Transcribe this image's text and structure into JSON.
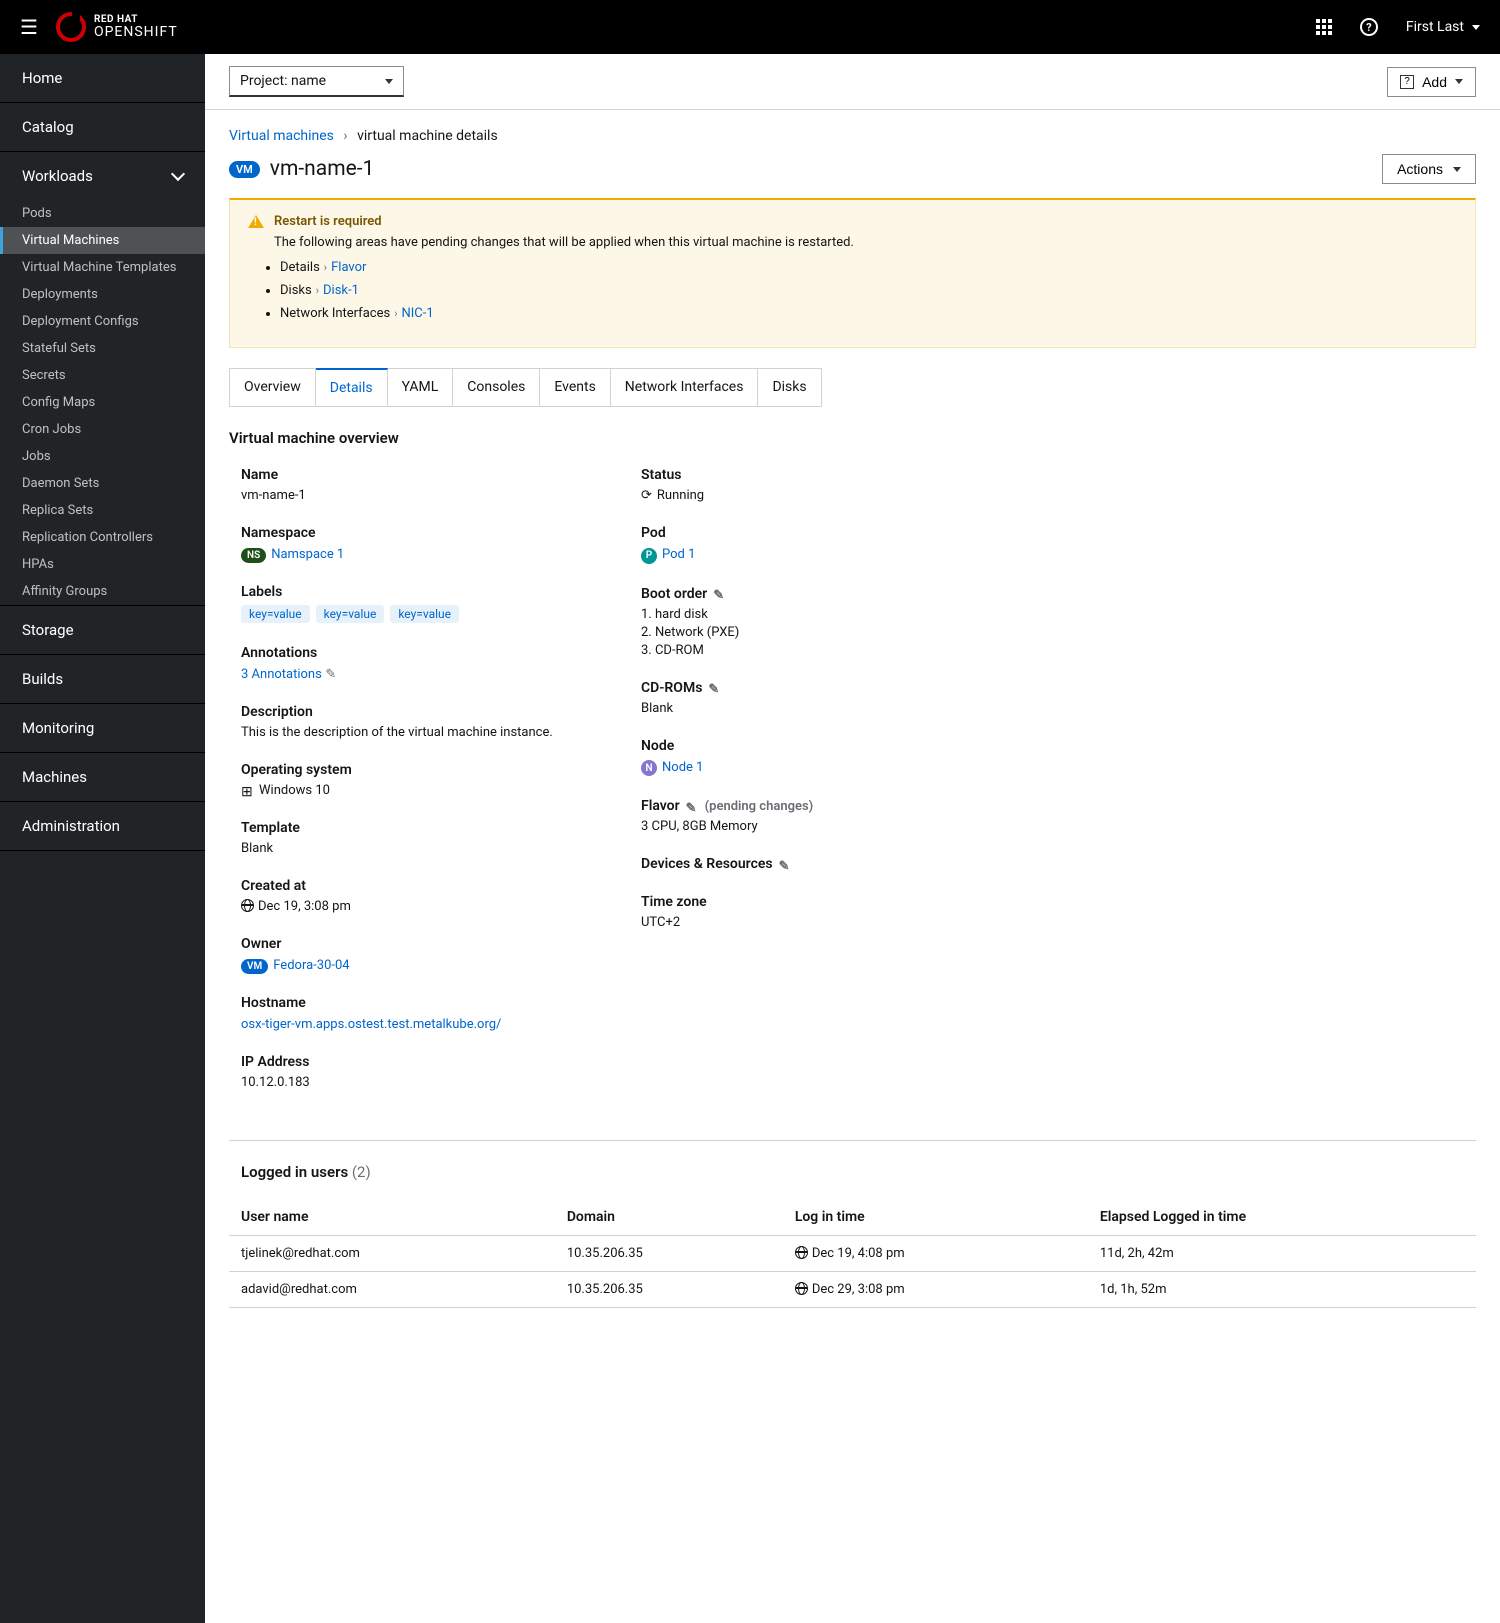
{
  "brand": {
    "top": "RED HAT",
    "bot": "OPENSHIFT"
  },
  "user": "First Last",
  "nav": {
    "home": "Home",
    "catalog": "Catalog",
    "workloads": "Workloads",
    "storage": "Storage",
    "builds": "Builds",
    "monitoring": "Monitoring",
    "machines": "Machines",
    "administration": "Administration",
    "sub": {
      "pods": "Pods",
      "vms": "Virtual Machines",
      "vmt": "Virtual Machine Templates",
      "deploy": "Deployments",
      "depconf": "Deployment Configs",
      "sts": "Stateful Sets",
      "secrets": "Secrets",
      "cm": "Config Maps",
      "cron": "Cron Jobs",
      "jobs": "Jobs",
      "ds": "Daemon Sets",
      "rs": "Replica Sets",
      "rc": "Replication Controllers",
      "hpa": "HPAs",
      "ag": "Affinity Groups"
    }
  },
  "toolbar": {
    "project": "Project: name",
    "add": "Add"
  },
  "breadcrumb": {
    "parent": "Virtual machines",
    "current": "virtual machine details"
  },
  "title": {
    "badge": "VM",
    "name": "vm-name-1",
    "actions": "Actions"
  },
  "alert": {
    "title": "Restart is required",
    "body": "The following areas have pending changes that will be applied when this virtual machine is restarted.",
    "items": [
      {
        "label": "Details",
        "link": "Flavor"
      },
      {
        "label": "Disks",
        "link": "Disk-1"
      },
      {
        "label": "Network Interfaces",
        "link": "NIC-1"
      }
    ]
  },
  "tabs": [
    "Overview",
    "Details",
    "YAML",
    "Consoles",
    "Events",
    "Network Interfaces",
    "Disks"
  ],
  "overview": {
    "heading": "Virtual machine overview",
    "left": {
      "name_l": "Name",
      "name_v": "vm-name-1",
      "ns_l": "Namespace",
      "ns_badge": "NS",
      "ns_v": "Namspace 1",
      "labels_l": "Labels",
      "labels": [
        "key=value",
        "key=value",
        "key=value"
      ],
      "ann_l": "Annotations",
      "ann_v": "3 Annotations",
      "desc_l": "Description",
      "desc_v": "This is the description of the virtual machine instance.",
      "os_l": "Operating system",
      "os_v": "Windows 10",
      "tpl_l": "Template",
      "tpl_v": "Blank",
      "created_l": "Created at",
      "created_v": "Dec 19, 3:08 pm",
      "owner_l": "Owner",
      "owner_badge": "VM",
      "owner_v": "Fedora-30-04",
      "host_l": "Hostname",
      "host_v": "osx-tiger-vm.apps.ostest.test.metalkube.org/",
      "ip_l": "IP Address",
      "ip_v": "10.12.0.183"
    },
    "right": {
      "status_l": "Status",
      "status_v": "Running",
      "pod_l": "Pod",
      "pod_badge": "P",
      "pod_v": "Pod 1",
      "boot_l": "Boot order",
      "boot": [
        "1. hard disk",
        "2. Network (PXE)",
        "3. CD-ROM"
      ],
      "cd_l": "CD-ROMs",
      "cd_v": "Blank",
      "node_l": "Node",
      "node_badge": "N",
      "node_v": "Node 1",
      "flavor_l": "Flavor",
      "flavor_pending": "(pending changes)",
      "flavor_v": "3 CPU, 8GB Memory",
      "dev_l": "Devices & Resources",
      "tz_l": "Time zone",
      "tz_v": "UTC+2"
    }
  },
  "users": {
    "title": "Logged in users",
    "count": "(2)",
    "cols": [
      "User name",
      "Domain",
      "Log in time",
      "Elapsed Logged in time"
    ],
    "rows": [
      {
        "user": "tjelinek@redhat.com",
        "domain": "10.35.206.35",
        "login": "Dec 19, 4:08 pm",
        "elapsed": "11d, 2h, 42m"
      },
      {
        "user": "adavid@redhat.com",
        "domain": "10.35.206.35",
        "login": "Dec 29, 3:08 pm",
        "elapsed": "1d, 1h, 52m"
      }
    ]
  }
}
